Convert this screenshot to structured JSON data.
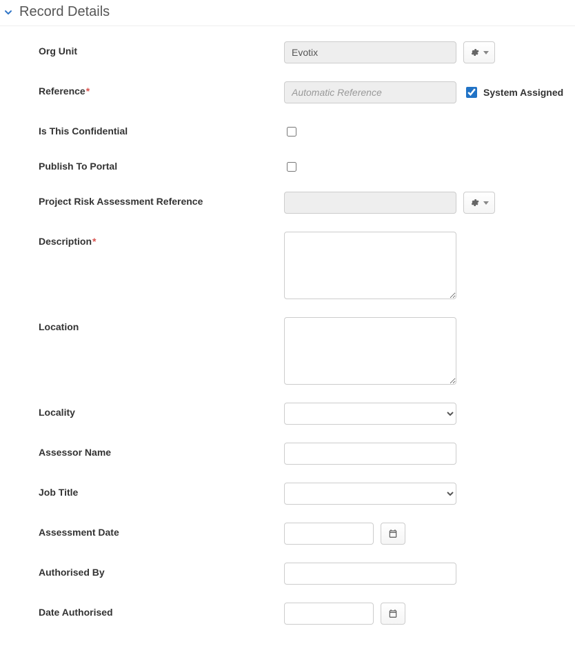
{
  "header": {
    "title": "Record Details"
  },
  "fields": {
    "org_unit": {
      "label": "Org Unit",
      "value": "Evotix"
    },
    "reference": {
      "label": "Reference",
      "placeholder": "Automatic Reference",
      "system_assigned_label": "System Assigned",
      "system_assigned_checked": true
    },
    "confidential": {
      "label": "Is This Confidential",
      "checked": false
    },
    "publish_portal": {
      "label": "Publish To Portal",
      "checked": false
    },
    "project_risk_ref": {
      "label": "Project Risk Assessment Reference",
      "value": ""
    },
    "description": {
      "label": "Description",
      "value": ""
    },
    "location": {
      "label": "Location",
      "value": ""
    },
    "locality": {
      "label": "Locality",
      "value": ""
    },
    "assessor_name": {
      "label": "Assessor Name",
      "value": ""
    },
    "job_title": {
      "label": "Job Title",
      "value": ""
    },
    "assessment_date": {
      "label": "Assessment Date",
      "value": ""
    },
    "authorised_by": {
      "label": "Authorised By",
      "value": ""
    },
    "date_authorised": {
      "label": "Date Authorised",
      "value": ""
    }
  }
}
